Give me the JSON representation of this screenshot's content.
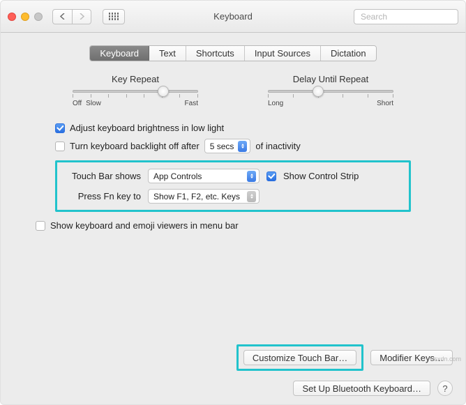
{
  "titlebar": {
    "title": "Keyboard",
    "search_placeholder": "Search"
  },
  "tabs": {
    "items": [
      {
        "label": "Keyboard",
        "active": true
      },
      {
        "label": "Text",
        "active": false
      },
      {
        "label": "Shortcuts",
        "active": false
      },
      {
        "label": "Input Sources",
        "active": false
      },
      {
        "label": "Dictation",
        "active": false
      }
    ]
  },
  "sliders": {
    "key_repeat": {
      "title": "Key Repeat",
      "left_label": "Off",
      "left_label2": "Slow",
      "right_label": "Fast",
      "value_pct": 72,
      "ticks": 8
    },
    "delay_until_repeat": {
      "title": "Delay Until Repeat",
      "left_label": "Long",
      "right_label": "Short",
      "value_pct": 40,
      "ticks": 6
    }
  },
  "options": {
    "adjust_brightness": {
      "label": "Adjust keyboard brightness in low light",
      "checked": true
    },
    "backlight_off": {
      "label_pre": "Turn keyboard backlight off after",
      "value": "5 secs",
      "label_post": "of inactivity",
      "checked": false
    },
    "touchbar": {
      "label": "Touch Bar shows",
      "value": "App Controls"
    },
    "show_control_strip": {
      "label": "Show Control Strip",
      "checked": true
    },
    "press_fn": {
      "label": "Press Fn key to",
      "value": "Show F1, F2, etc. Keys"
    },
    "menubar_viewers": {
      "label": "Show keyboard and emoji viewers in menu bar",
      "checked": false
    }
  },
  "buttons": {
    "customize_touch_bar": "Customize Touch Bar…",
    "modifier_keys": "Modifier Keys…",
    "bluetooth_keyboard": "Set Up Bluetooth Keyboard…",
    "help": "?"
  },
  "watermark": "wsxdn.com"
}
